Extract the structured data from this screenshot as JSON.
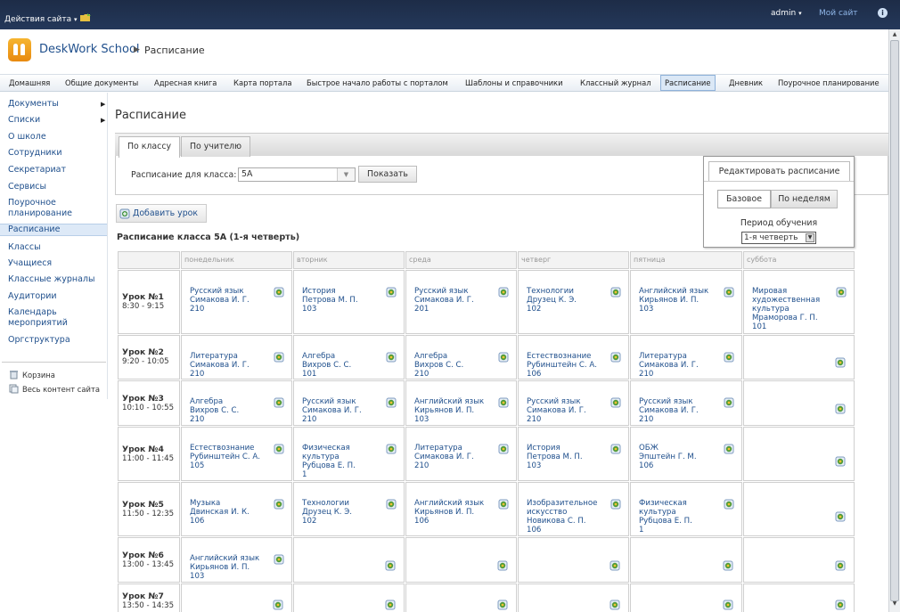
{
  "topbar": {
    "site_actions": "Действия сайта",
    "user": "admin",
    "my_site": "Мой сайт",
    "help": "i"
  },
  "header": {
    "site_title": "DeskWork School",
    "page": "Расписание"
  },
  "topnav": [
    "Домашняя",
    "Общие документы",
    "Адресная книга",
    "Карта портала",
    "Быстрое начало работы с порталом",
    "Шаблоны и справочники",
    "Классный журнал",
    "Расписание",
    "Дневник",
    "Поурочное планирование"
  ],
  "topnav_selected": 7,
  "leftnav": [
    "Документы",
    "Списки",
    "О школе",
    "Сотрудники",
    "Секретариат",
    "Сервисы",
    "Поурочное планирование",
    "Расписание",
    "Классы",
    "Учащиеся",
    "Классные журналы",
    "Аудитории",
    "Календарь мероприятий",
    "Оргструктура"
  ],
  "leftnav_selected": 7,
  "leftnav_bottom": [
    "Корзина",
    "Весь контент сайта"
  ],
  "main": {
    "heading": "Расписание",
    "tabs": [
      "По классу",
      "По учителю"
    ],
    "filter_label": "Расписание для класса:",
    "class_value": "5А",
    "show_button": "Показать",
    "add_lesson": "Добавить урок",
    "schedule_title": "Расписание класса 5А (1-я четверть)"
  },
  "edit_panel": {
    "title": "Редактировать расписание",
    "mode_base": "Базовое",
    "mode_weeks": "По неделям",
    "period_label": "Период обучения",
    "period_value": "1-я четверть"
  },
  "timetable": {
    "days": [
      "понедельник",
      "вторник",
      "среда",
      "четверг",
      "пятница",
      "суббота"
    ],
    "lessons": [
      {
        "name": "Урок №1",
        "time": "8:30 - 9:15",
        "cells": [
          "Русский язык\nСимакова И. Г.\n210",
          "История\nПетрова М. П.\n103",
          "Русский язык\nСимакова И. Г.\n201",
          "Технологии\nДрузец К. Э.\n102",
          "Английский язык\nКирьянов И. П.\n103",
          "Мировая\nхудожественная\nкультура\nМраморова Г. П.\n101"
        ]
      },
      {
        "name": "Урок №2",
        "time": "9:20 - 10:05",
        "cells": [
          "Литература\nСимакова И. Г.\n210",
          "Алгебра\nВихров С. С.\n101",
          "Алгебра\nВихров С. С.\n210",
          "Естествознание\nРубинштейн С. А.\n106",
          "Литература\nСимакова И. Г.\n210",
          ""
        ]
      },
      {
        "name": "Урок №3",
        "time": "10:10 - 10:55",
        "cells": [
          "Алгебра\nВихров С. С.\n210",
          "Русский язык\nСимакова И. Г.\n210",
          "Английский язык\nКирьянов И. П.\n103",
          "Русский язык\nСимакова И. Г.\n210",
          "Русский язык\nСимакова И. Г.\n210",
          ""
        ]
      },
      {
        "name": "Урок №4",
        "time": "11:00 - 11:45",
        "cells": [
          "Естествознание\nРубинштейн С. А.\n105",
          "Физическая\nкультура\nРубцова Е. П.\n1",
          "Литература\nСимакова И. Г.\n210",
          "История\nПетрова М. П.\n103",
          "ОБЖ\nЭпштейн Г. М.\n106",
          ""
        ]
      },
      {
        "name": "Урок №5",
        "time": "11:50 - 12:35",
        "cells": [
          "Музыка\nДвинская И. К.\n106",
          "Технологии\nДрузец К. Э.\n102",
          "Английский язык\nКирьянов И. П.\n106",
          "Изобразительное\nискусство\nНовикова С. П.\n106",
          "Физическая\nкультура\nРубцова Е. П.\n1",
          ""
        ]
      },
      {
        "name": "Урок №6",
        "time": "13:00 - 13:45",
        "cells": [
          "Английский язык\nКирьянов И. П.\n103",
          "",
          "",
          "",
          "",
          ""
        ]
      },
      {
        "name": "Урок №7",
        "time": "13:50 - 14:35",
        "cells": [
          "",
          "",
          "",
          "",
          "",
          ""
        ]
      }
    ]
  },
  "colors": {
    "topbar": "#1d2c47",
    "link": "#1f4f8c",
    "accent": "#e88a10"
  }
}
